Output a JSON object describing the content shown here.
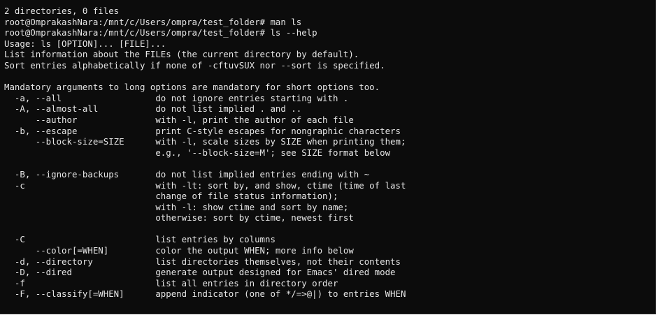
{
  "terminal": {
    "lines": [
      "2 directories, 0 files",
      "root@OmprakashNara:/mnt/c/Users/ompra/test_folder# man ls",
      "root@OmprakashNara:/mnt/c/Users/ompra/test_folder# ls --help",
      "Usage: ls [OPTION]... [FILE]...",
      "List information about the FILEs (the current directory by default).",
      "Sort entries alphabetically if none of -cftuvSUX nor --sort is specified.",
      "",
      "Mandatory arguments to long options are mandatory for short options too.",
      "  -a, --all                  do not ignore entries starting with .",
      "  -A, --almost-all           do not list implied . and ..",
      "      --author               with -l, print the author of each file",
      "  -b, --escape               print C-style escapes for nongraphic characters",
      "      --block-size=SIZE      with -l, scale sizes by SIZE when printing them;",
      "                             e.g., '--block-size=M'; see SIZE format below",
      "",
      "  -B, --ignore-backups       do not list implied entries ending with ~",
      "  -c                         with -lt: sort by, and show, ctime (time of last",
      "                             change of file status information);",
      "                             with -l: show ctime and sort by name;",
      "                             otherwise: sort by ctime, newest first",
      "",
      "  -C                         list entries by columns",
      "      --color[=WHEN]         color the output WHEN; more info below",
      "  -d, --directory            list directories themselves, not their contents",
      "  -D, --dired                generate output designed for Emacs' dired mode",
      "  -f                         list all entries in directory order",
      "  -F, --classify[=WHEN]      append indicator (one of */=>@|) to entries WHEN"
    ]
  },
  "colors": {
    "background": "#0c0c0c",
    "foreground": "#e6e6e6"
  }
}
